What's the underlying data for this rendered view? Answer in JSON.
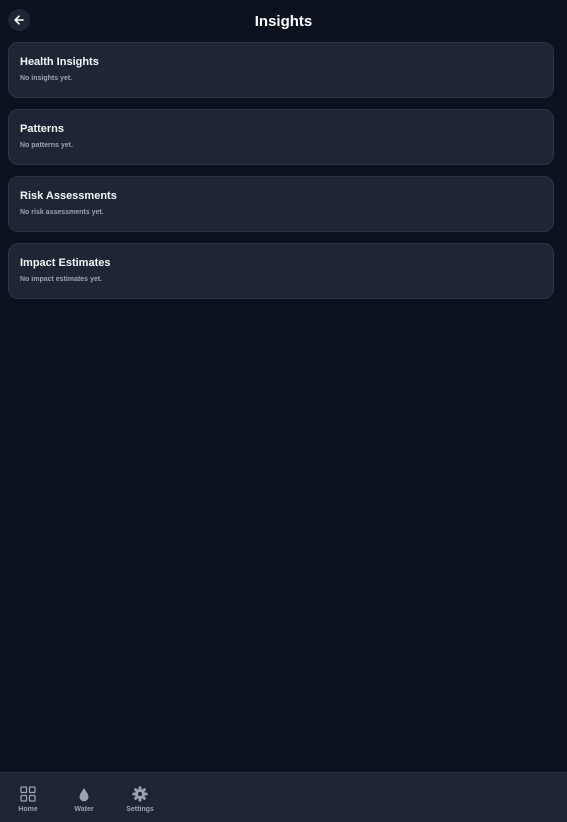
{
  "header": {
    "title": "Insights",
    "back_icon": "arrow-left-icon"
  },
  "cards": [
    {
      "title": "Health Insights",
      "empty_text": "No insights yet."
    },
    {
      "title": "Patterns",
      "empty_text": "No patterns yet."
    },
    {
      "title": "Risk Assessments",
      "empty_text": "No risk assessments yet."
    },
    {
      "title": "Impact Estimates",
      "empty_text": "No impact estimates yet."
    }
  ],
  "bottom_nav": {
    "items": [
      {
        "label": "Home",
        "icon": "grid-icon"
      },
      {
        "label": "Water",
        "icon": "water-drop-icon"
      },
      {
        "label": "Settings",
        "icon": "gear-icon"
      }
    ]
  },
  "colors": {
    "background": "#0b121e",
    "card": "#1e2635",
    "card_border": "#2b3444",
    "nav": "#1e2636",
    "muted_text": "#9aa3b2"
  }
}
